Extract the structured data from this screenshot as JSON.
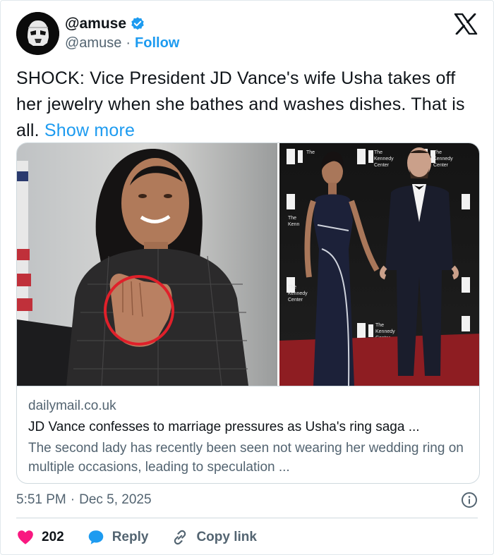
{
  "user": {
    "display_name": "@amuse",
    "handle": "@amuse",
    "separator": "·",
    "follow_label": "Follow"
  },
  "tweet": {
    "text": "SHOCK: Vice President JD Vance's wife Usha takes off her jewelry when she bathes and washes dishes. That is all.",
    "show_more": "Show more"
  },
  "link_card": {
    "domain": "dailymail.co.uk",
    "title": "JD Vance confesses to marriage pressures as Usha's ring saga ...",
    "description": "The second lady has recently been seen not wearing her wedding ring on multiple occasions, leading to speculation ...",
    "backdrop_text": "The Kennedy Center"
  },
  "meta": {
    "time": "5:51 PM",
    "separator": "·",
    "date": "Dec 5, 2025"
  },
  "actions": {
    "likes": "202",
    "reply": "Reply",
    "copy_link": "Copy link"
  },
  "colors": {
    "accent": "#1d9bf0",
    "like": "#f91880",
    "text_primary": "#0f1419",
    "text_secondary": "#536471",
    "highlight_circle": "#e0202a"
  },
  "icons": {
    "verified": "verified-badge-icon",
    "x_logo": "x-logo-icon",
    "info": "info-icon",
    "like": "heart-icon",
    "reply": "speech-bubble-icon",
    "copy_link": "link-icon"
  }
}
